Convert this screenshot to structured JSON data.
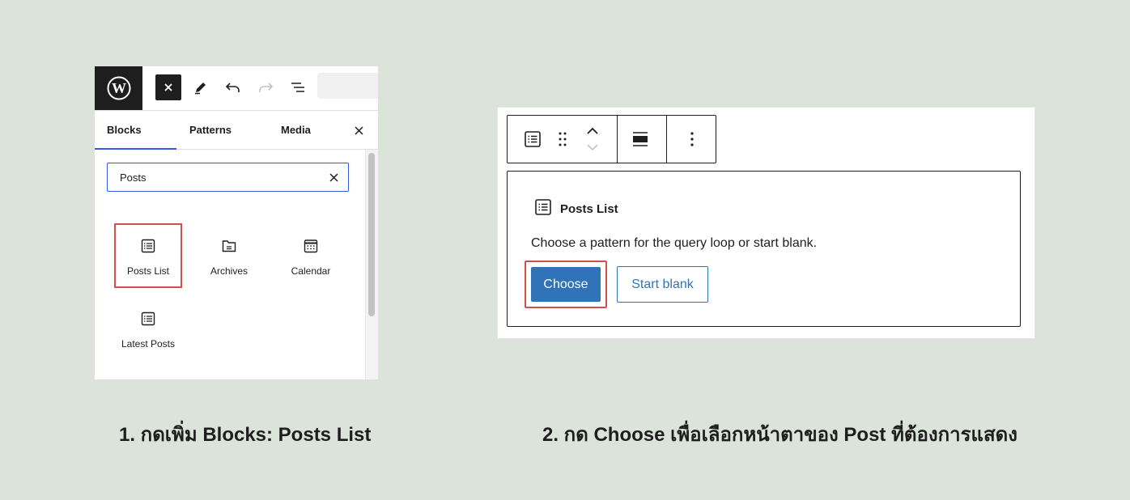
{
  "colors": {
    "background": "#dce3db",
    "accent": "#3858e9",
    "primary_button": "#3073b8",
    "highlight_border": "#d0504a",
    "dark": "#1e1e1e"
  },
  "editor": {
    "toolbar": {
      "logo_icon": "wordpress-logo-icon",
      "close_icon": "close-icon",
      "edit_icon": "pencil-icon",
      "undo_icon": "undo-icon",
      "redo_icon": "redo-icon",
      "outline_icon": "list-view-icon"
    },
    "tabs": [
      {
        "label": "Blocks",
        "active": true
      },
      {
        "label": "Patterns",
        "active": false
      },
      {
        "label": "Media",
        "active": false
      }
    ],
    "search": {
      "value": "Posts"
    },
    "blocks": [
      {
        "label": "Posts List",
        "icon": "posts-list-icon",
        "highlighted": true
      },
      {
        "label": "Archives",
        "icon": "archives-icon",
        "highlighted": false
      },
      {
        "label": "Calendar",
        "icon": "calendar-icon",
        "highlighted": false
      },
      {
        "label": "Latest Posts",
        "icon": "latest-posts-icon",
        "highlighted": false
      }
    ]
  },
  "query_block": {
    "toolbar_icons": [
      "posts-list-icon",
      "drag-handle-icon",
      "move-up-icon",
      "move-down-icon",
      "align-icon",
      "more-options-icon"
    ],
    "title": "Posts List",
    "instructions": "Choose a pattern for the query loop or start blank.",
    "choose_label": "Choose",
    "start_blank_label": "Start blank"
  },
  "captions": {
    "step1": "1. กดเพิ่ม Blocks: Posts List",
    "step2": "2. กด Choose เพื่อเลือกหน้าตาของ Post ที่ต้องการแสดง"
  }
}
